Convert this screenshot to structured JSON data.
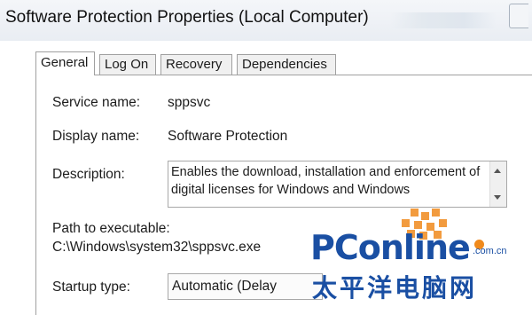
{
  "window": {
    "title": "Software Protection Properties (Local Computer)"
  },
  "tabs": [
    "General",
    "Log On",
    "Recovery",
    "Dependencies"
  ],
  "general": {
    "service_name_label": "Service name:",
    "service_name_value": "sppsvc",
    "display_name_label": "Display name:",
    "display_name_value": "Software Protection",
    "description_label": "Description:",
    "description_value": "Enables the download, installation and enforcement of digital licenses for Windows and Windows",
    "path_label": "Path to executable:",
    "path_value": "C:\\Windows\\system32\\sppsvc.exe",
    "startup_type_label": "Startup type:",
    "startup_type_value": "Automatic (Delay"
  },
  "watermark": {
    "brand": "PConline",
    "suffix": ".com.cn",
    "chinese": "太平洋电脑网",
    "colors": {
      "blue": "#1a4fa3",
      "orange": "#f08a1c"
    }
  }
}
